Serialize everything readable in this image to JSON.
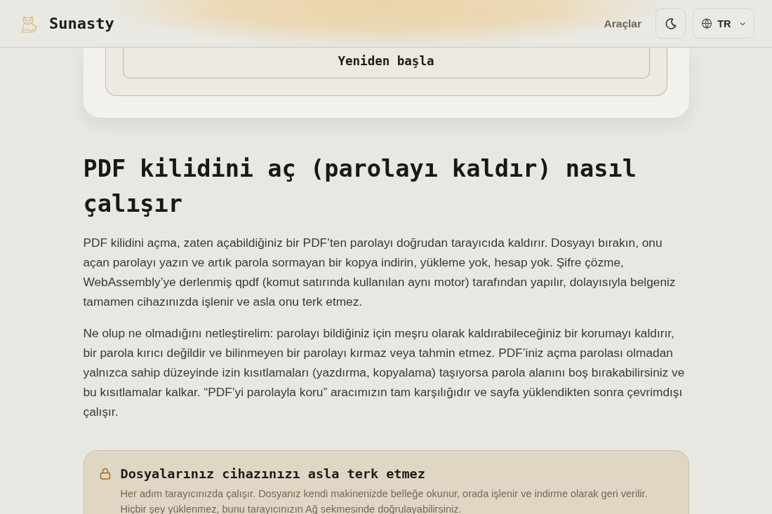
{
  "header": {
    "brand": "Sunasty",
    "nav_link": "Araçlar",
    "language": "TR"
  },
  "tool_card": {
    "button": "Yeniden başla"
  },
  "article": {
    "heading": "PDF kilidini aç (parolayı kaldır) nasıl çalışır",
    "paragraphs": [
      "PDF kilidini açma, zaten açabildiğiniz bir PDF’ten parolayı doğrudan tarayıcıda kaldırır. Dosyayı bırakın, onu açan parolayı yazın ve artık parola sormayan bir kopya indirin, yükleme yok, hesap yok. Şifre çözme, WebAssembly’ye derlenmiş qpdf (komut satırında kullanılan aynı motor) tarafından yapılır, dolayısıyla belgeniz tamamen cihazınızda işlenir ve asla onu terk etmez.",
      "Ne olup ne olmadığını netleştirelim: parolayı bildiğiniz için meşru olarak kaldırabileceğiniz bir korumayı kaldırır, bir parola kırıcı değildir ve bilinmeyen bir parolayı kırmaz veya tahmin etmez. PDF’iniz açma parolası olmadan yalnızca sahip düzeyinde izin kısıtlamaları (yazdırma, kopyalama) taşıyorsa parola alanını boş bırakabilirsiniz ve bu kısıtlamalar kalkar. “PDF’yi parolayla koru” aracımızın tam karşılığıdır ve sayfa yüklendikten sonra çevrimdışı çalışır."
    ]
  },
  "notice": {
    "title": "Dosyalarınız cihazınızı asla terk etmez",
    "text": "Her adım tarayıcınızda çalışır. Dosyanız kendi makinenizde belleğe okunur, orada işlenir ve indirme olarak geri verilir. Hiçbir şey yüklenmez, bunu tarayıcınızın Ağ sekmesinde doğrulayabilirsiniz."
  }
}
